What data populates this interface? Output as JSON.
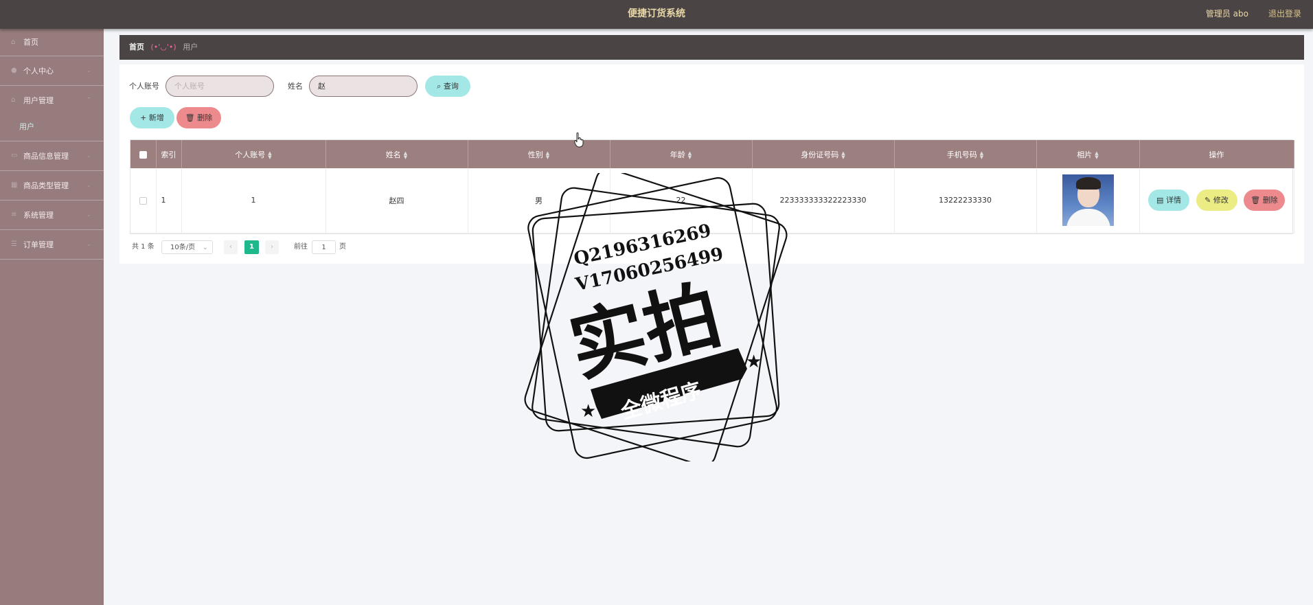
{
  "header": {
    "title": "便捷订货系统",
    "user": "管理员 abo",
    "logout": "退出登录"
  },
  "sidebar": {
    "items": [
      {
        "label": "首页",
        "icon": "home-icon"
      },
      {
        "label": "个人中心",
        "icon": "user-icon"
      },
      {
        "label": "用户管理",
        "icon": "users-icon"
      },
      {
        "label": "商品信息管理",
        "icon": "goods-icon"
      },
      {
        "label": "商品类型管理",
        "icon": "category-icon"
      },
      {
        "label": "系统管理",
        "icon": "settings-icon"
      },
      {
        "label": "订单管理",
        "icon": "order-icon"
      }
    ],
    "subitem": "用户"
  },
  "breadcrumb": {
    "home": "首页",
    "separator": "(•'◡'•)",
    "current": "用户"
  },
  "search": {
    "account_label": "个人账号",
    "account_placeholder": "个人账号",
    "account_value": "",
    "name_label": "姓名",
    "name_value": "赵",
    "search_button": "查询"
  },
  "actions": {
    "add": "新增",
    "delete": "删除"
  },
  "table": {
    "headers": [
      "索引",
      "个人账号",
      "姓名",
      "性别",
      "年龄",
      "身份证号码",
      "手机号码",
      "相片",
      "操作"
    ],
    "rows": [
      {
        "index": "1",
        "account": "1",
        "name": "赵四",
        "gender": "男",
        "age": "22",
        "id_number": "223333333322223330",
        "phone": "13222233330"
      }
    ],
    "row_actions": {
      "detail": "详情",
      "edit": "修改",
      "delete": "删除"
    }
  },
  "pagination": {
    "total": "共 1 条",
    "page_size": "10条/页",
    "current_page": "1",
    "goto_label": "前往",
    "goto_value": "1",
    "page_suffix": "页"
  },
  "watermark": {
    "line1": "Q2196316269",
    "line2": "V17060256499",
    "main": "实拍",
    "banner": "全微程序"
  },
  "colors": {
    "topbar": "#4b4444",
    "sidebar": "#967c7c",
    "table_header": "#9c8080",
    "cyan_button": "#a3e8e6",
    "pink_button": "#ec8a8d",
    "yellow_button": "#ecec84",
    "active_page": "#1fb88a"
  }
}
